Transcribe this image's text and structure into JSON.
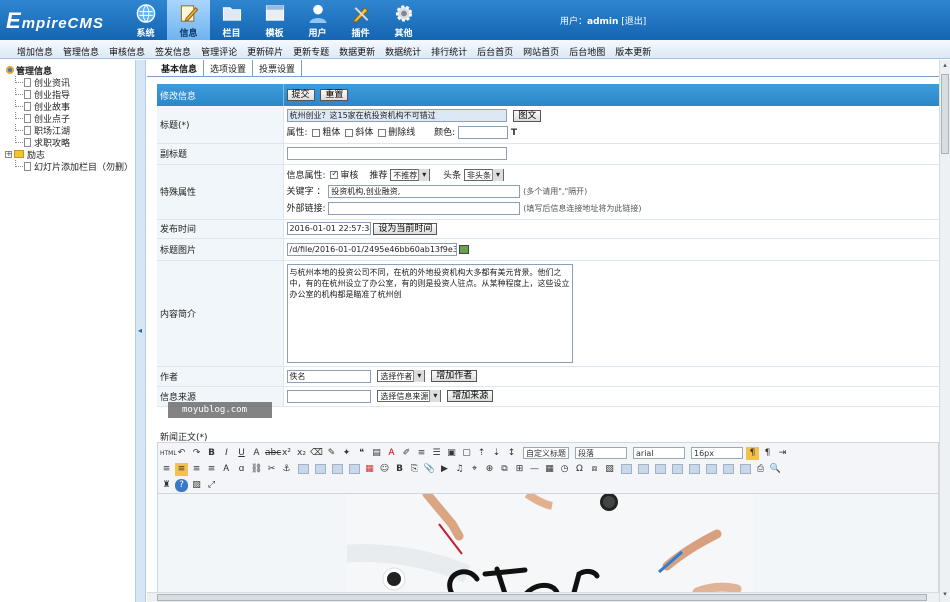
{
  "logo": {
    "first": "E",
    "rest": "mpireCMS"
  },
  "topnav": [
    {
      "label": "系统",
      "icon": "globe-icon"
    },
    {
      "label": "信息",
      "icon": "edit-document-icon"
    },
    {
      "label": "栏目",
      "icon": "folder-icon"
    },
    {
      "label": "模板",
      "icon": "template-window-icon"
    },
    {
      "label": "用户",
      "icon": "user-icon"
    },
    {
      "label": "插件",
      "icon": "tools-icon"
    },
    {
      "label": "其他",
      "icon": "gear-icon"
    }
  ],
  "user": {
    "prefix": "用户：",
    "name": "admin",
    "logout": "[退出]"
  },
  "submenu": [
    "增加信息",
    "管理信息",
    "审核信息",
    "签发信息",
    "管理评论",
    "更新碎片",
    "更新专题",
    "数据更新",
    "数据统计",
    "排行统计",
    "后台首页",
    "网站首页",
    "后台地图",
    "版本更新"
  ],
  "tree": {
    "root": "管理信息",
    "items": [
      "创业资讯",
      "创业指导",
      "创业故事",
      "创业点子",
      "职场江湖",
      "求职攻略"
    ],
    "folder": "励志",
    "last": "幻灯片添加栏目（勿删）"
  },
  "tabs": [
    "基本信息",
    "选项设置",
    "投票设置"
  ],
  "form": {
    "header_label": "修改信息",
    "submit": "提交",
    "reset": "重置",
    "title_label": "标题(*)",
    "title_value": "杭州创业？这15家在杭投资机构不可错过",
    "title_btn": "图文",
    "attr_label": "属性:",
    "bold": "粗体",
    "italic": "斜体",
    "strike": "删除线",
    "color_label": "颜色:",
    "subtitle_label": "副标题",
    "special_label": "特殊属性",
    "info_attr": "信息属性:",
    "review": "审核",
    "recommend": "推荐",
    "recommend_sel": "不推荐",
    "headline": "头条",
    "headline_sel": "非头条",
    "keywords_label": "关键字  ：",
    "keywords_value": "投资机构,创业融资,",
    "keywords_hint": "(多个请用\",\"隔开)",
    "link_label": "外部链接:",
    "link_hint": "(填写后信息连接地址将为此链接)",
    "pubtime_label": "发布时间",
    "pubtime_value": "2016-01-01 22:57:34",
    "pubtime_btn": "设为当前时间",
    "titlepic_label": "标题图片",
    "titlepic_value": "/d/file/2016-01-01/2495e46bb60ab13f9e3fd",
    "summary_label": "内容简介",
    "summary_value": "与杭州本地的投资公司不同，在杭的外地投资机构大多都有美元背景。他们之中，有的在杭州设立了办公室，有的则是投资人驻点。从某种程度上，这些设立办公室的机构都是瞄准了杭州创",
    "author_label": "作者",
    "author_value": "佚名",
    "author_sel": "选择作者",
    "author_btn": "增加作者",
    "source_label": "信息来源",
    "source_sel": "选择信息来源",
    "source_btn": "增加来源",
    "body_label": "新闻正文(*)"
  },
  "watermark": "moyublog.com",
  "editor": {
    "style_sel": "自定义标题",
    "format_sel": "段落",
    "font_sel": "arial",
    "size_sel": "16px"
  },
  "colors": {
    "topbar": "#1f77c4",
    "header": "#3396d8"
  }
}
